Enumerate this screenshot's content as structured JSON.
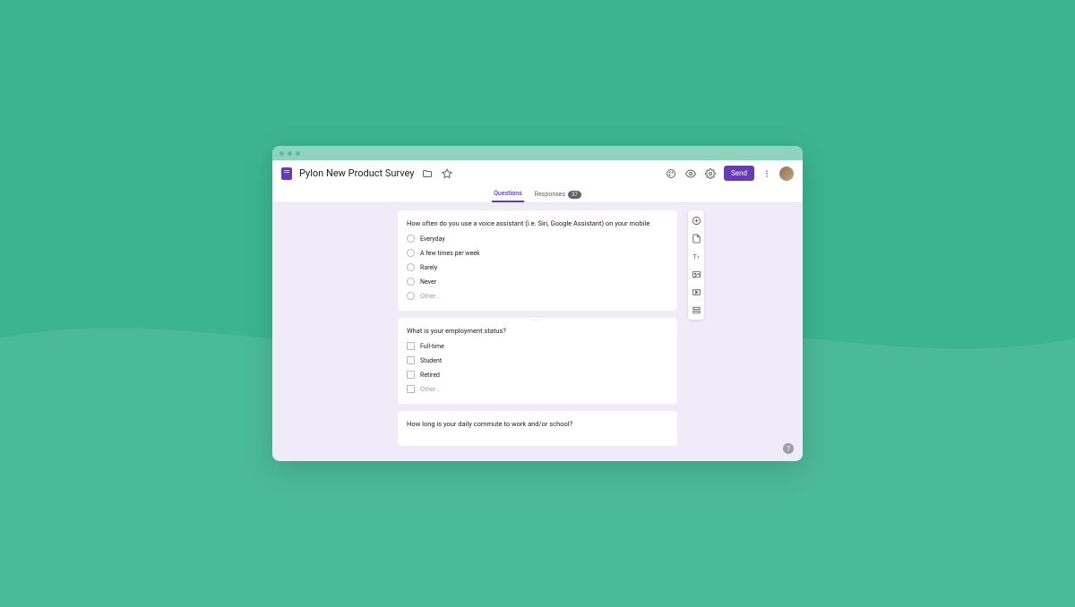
{
  "header": {
    "title": "Pylon New Product Survey",
    "send_label": "Send",
    "tabs": {
      "questions": "Questions",
      "responses": "Responses",
      "responses_count": "37"
    }
  },
  "questions": [
    {
      "type": "radio",
      "title": "How often do you use a voice assistant (i.e. Siri, Google Assistant) on your mobile",
      "options": [
        "Everyday",
        "A few times per week",
        "Rarely",
        "Never",
        "Other..."
      ]
    },
    {
      "type": "checkbox",
      "title": "What is your employment status?",
      "options": [
        "Full-time",
        "Student",
        "Retired",
        "Other..."
      ]
    },
    {
      "type": "radio",
      "title": "How long is your daily commute to work and/or school?",
      "options": []
    }
  ],
  "help": "?"
}
